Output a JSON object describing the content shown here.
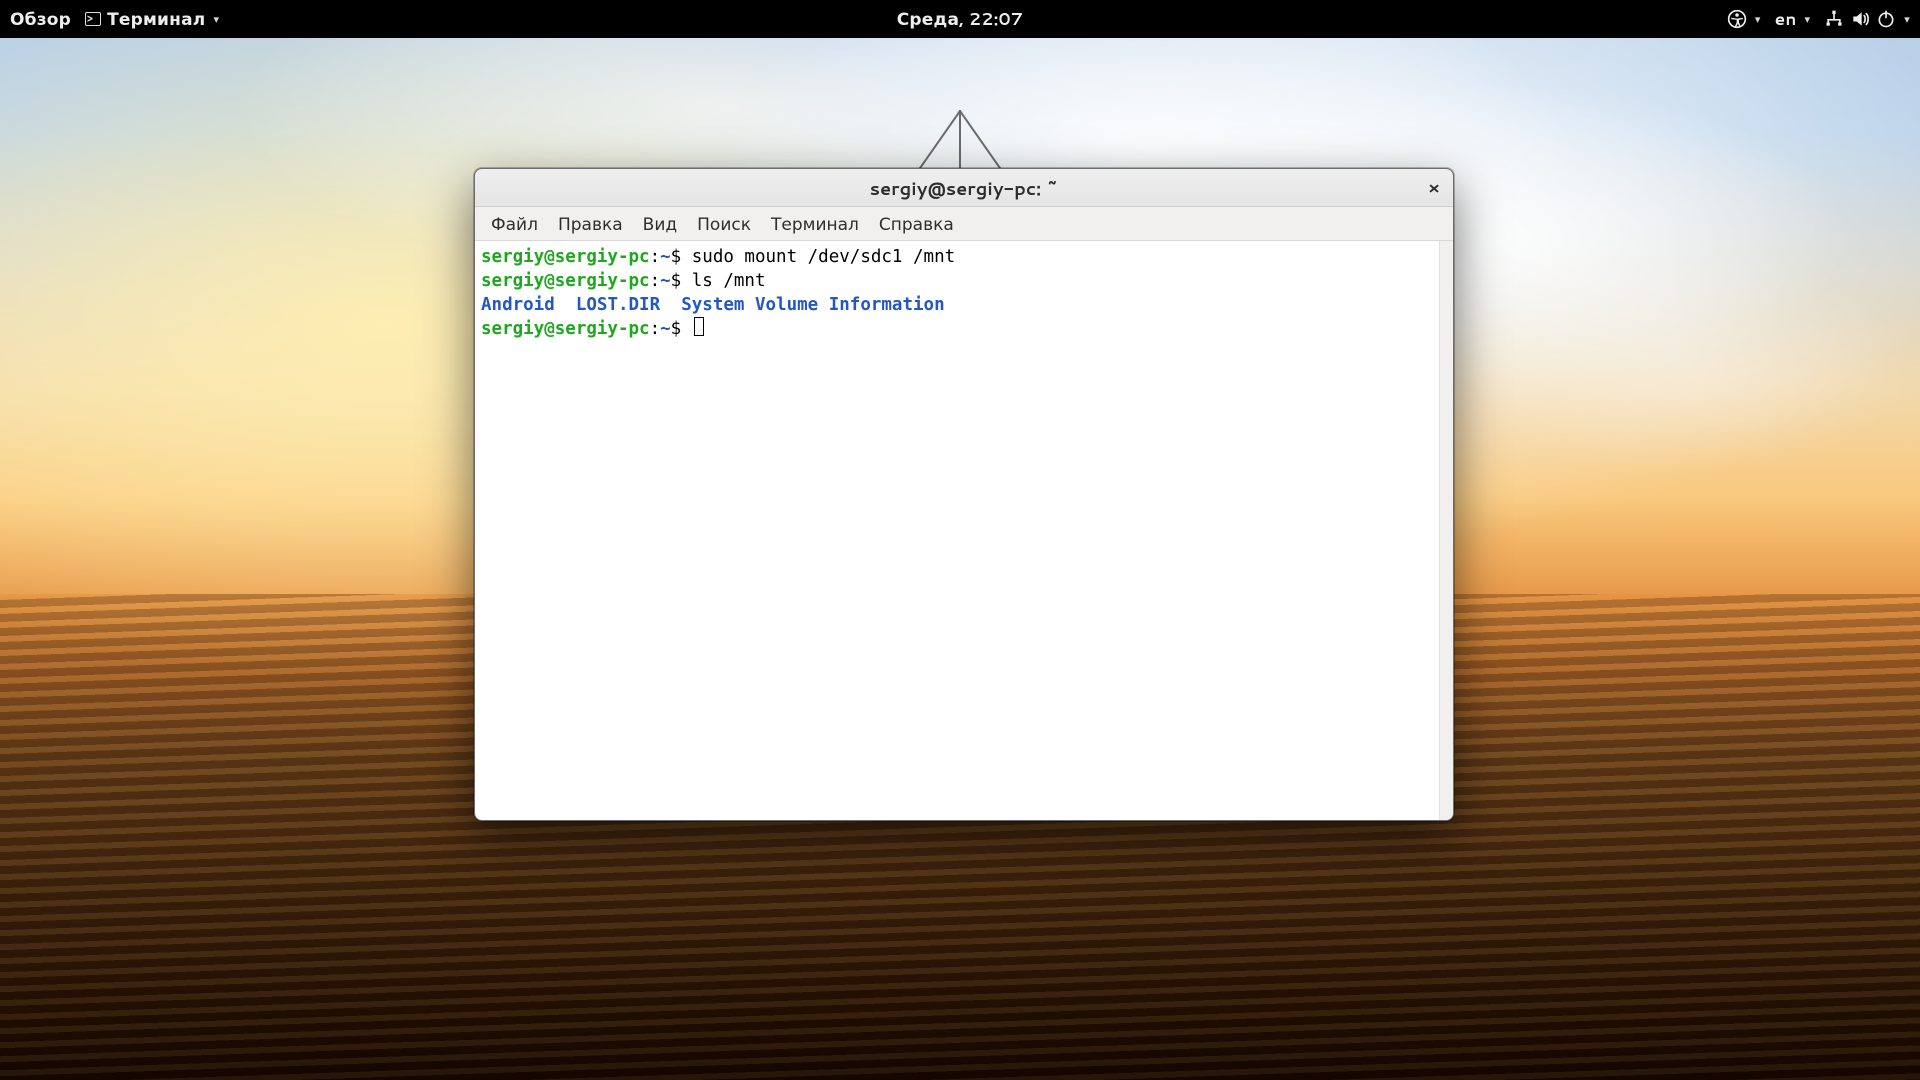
{
  "topbar": {
    "activities": "Обзор",
    "app_name": "Терминал",
    "clock": "Среда, 22:07",
    "input_lang": "en"
  },
  "window": {
    "title": "sergiy@sergiy-pc: ~",
    "close_glyph": "×",
    "menus": [
      "Файл",
      "Правка",
      "Вид",
      "Поиск",
      "Терминал",
      "Справка"
    ]
  },
  "terminal": {
    "prompt_user": "sergiy@sergiy-pc",
    "prompt_sep": ":",
    "prompt_path": "~",
    "prompt_end": "$ ",
    "lines": [
      {
        "cmd": "sudo mount /dev/sdc1 /mnt"
      },
      {
        "cmd": "ls /mnt"
      },
      {
        "out_dirs": [
          "Android",
          "LOST.DIR",
          "System Volume Information"
        ]
      },
      {
        "cmd": "",
        "cursor": true
      }
    ]
  }
}
